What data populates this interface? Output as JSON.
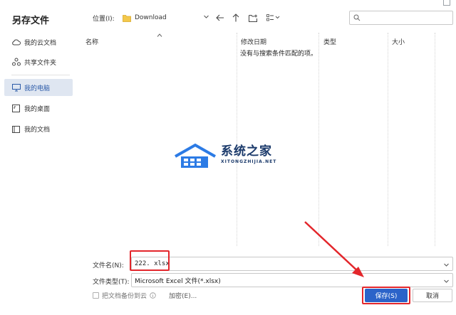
{
  "dialog": {
    "title": "另存文件"
  },
  "sidebar": {
    "items": [
      {
        "label": "我的云文档",
        "icon": "cloud-icon"
      },
      {
        "label": "共享文件夹",
        "icon": "share-icon"
      },
      {
        "label": "我的电脑",
        "icon": "computer-icon",
        "active": true
      },
      {
        "label": "我的桌面",
        "icon": "desktop-icon"
      },
      {
        "label": "我的文档",
        "icon": "documents-icon"
      }
    ]
  },
  "toolbar": {
    "location_label": "位置(I):",
    "location_value": "Download",
    "search_placeholder": ""
  },
  "file_list": {
    "columns": [
      "名称",
      "修改日期",
      "类型",
      "大小"
    ],
    "empty_message": "没有与搜索条件匹配的项。"
  },
  "watermark": {
    "cn": "系统之家",
    "en": "XITONGZHIJIA.NET"
  },
  "form": {
    "filename_label": "文件名(N):",
    "filename_value": "222. xlsx",
    "filetype_label": "文件类型(T):",
    "filetype_value": "Microsoft Excel 文件(*.xlsx)",
    "backup_label": "把文档备份到云",
    "encrypt_label": "加密(E)...",
    "save_label": "保存(S)",
    "cancel_label": "取消"
  },
  "colors": {
    "accent": "#2b63c9",
    "highlight": "#e3262b",
    "sidebar_active_bg": "#dfe6f1"
  }
}
